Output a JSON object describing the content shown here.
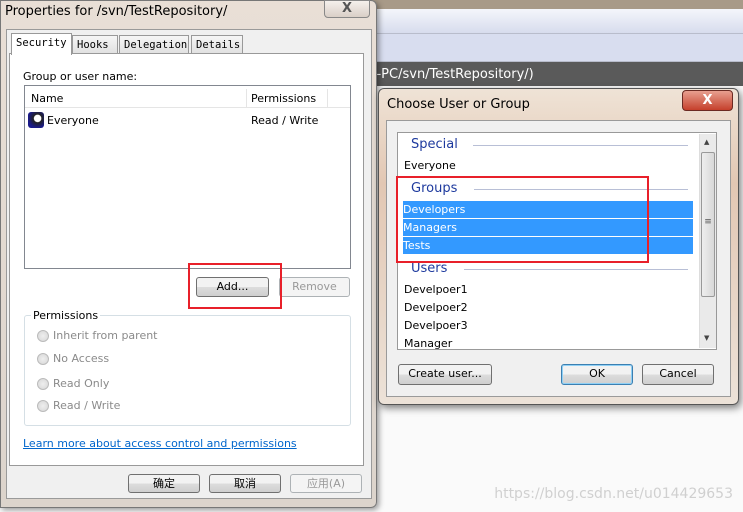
{
  "background": {
    "path_text": "ng-PC/svn/TestRepository/)",
    "watermark": "https://blog.csdn.net/u014429653"
  },
  "properties": {
    "title": "Properties for /svn/TestRepository/",
    "close_glyph": "X",
    "tabs": [
      {
        "label": "Security",
        "selected": true
      },
      {
        "label": "Hooks"
      },
      {
        "label": "Delegation"
      },
      {
        "label": "Details"
      }
    ],
    "group_label": "Group or user name:",
    "columns": [
      "Name",
      "Permissions"
    ],
    "rows": [
      {
        "name": "Everyone",
        "permissions": "Read / Write",
        "icon": "users-group-icon"
      }
    ],
    "add_label": "Add...",
    "remove_label": "Remove",
    "permissions_title": "Permissions",
    "radios": [
      "Inherit from parent",
      "No Access",
      "Read Only",
      "Read / Write"
    ],
    "link": "Learn more about access control and permissions",
    "ok_label": "确定",
    "cancel_label": "取消",
    "apply_label": "应用(A)"
  },
  "chooser": {
    "title": "Choose User or Group",
    "close_glyph": "X",
    "sections": {
      "special": "Special",
      "groups": "Groups",
      "users": "Users"
    },
    "special_items": [
      "Everyone"
    ],
    "group_items": [
      "Developers",
      "Managers",
      "Tests"
    ],
    "user_items": [
      "Develpoer1",
      "Develpoer2",
      "Develpoer3",
      "Manager"
    ],
    "create_label": "Create user...",
    "ok_label": "OK",
    "cancel_label": "Cancel"
  },
  "colors": {
    "selection": "#3399ff",
    "highlight_box": "#e8202a",
    "link": "#0066cc"
  }
}
